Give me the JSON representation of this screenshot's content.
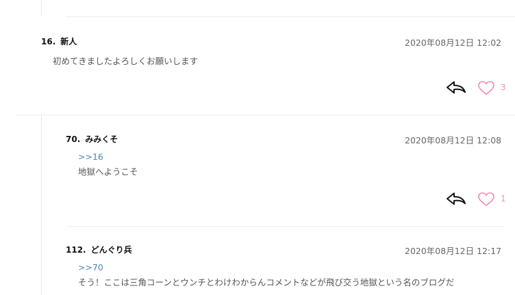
{
  "comments": [
    {
      "number": "16.",
      "name": "新人",
      "timestamp": "2020年08月12日 12:02",
      "quote": "",
      "text": "初めてきましたよろしくお願いします",
      "likes": "3"
    },
    {
      "number": "70.",
      "name": "みみくそ",
      "timestamp": "2020年08月12日 12:08",
      "quote": ">>16",
      "text": "地獄へようこそ",
      "likes": "1"
    },
    {
      "number": "112.",
      "name": "どんぐり兵",
      "timestamp": "2020年08月12日 12:17",
      "quote": ">>70",
      "text": "そう！ここは三角コーンとウンチとわけわからんコメントなどが飛び交う地獄という名のブログだ"
    }
  ],
  "icons": {
    "reply": "reply-arrow-icon",
    "like": "heart-outline-icon"
  },
  "colors": {
    "like_accent": "#f08cae",
    "quote_link": "#4a86b8"
  }
}
